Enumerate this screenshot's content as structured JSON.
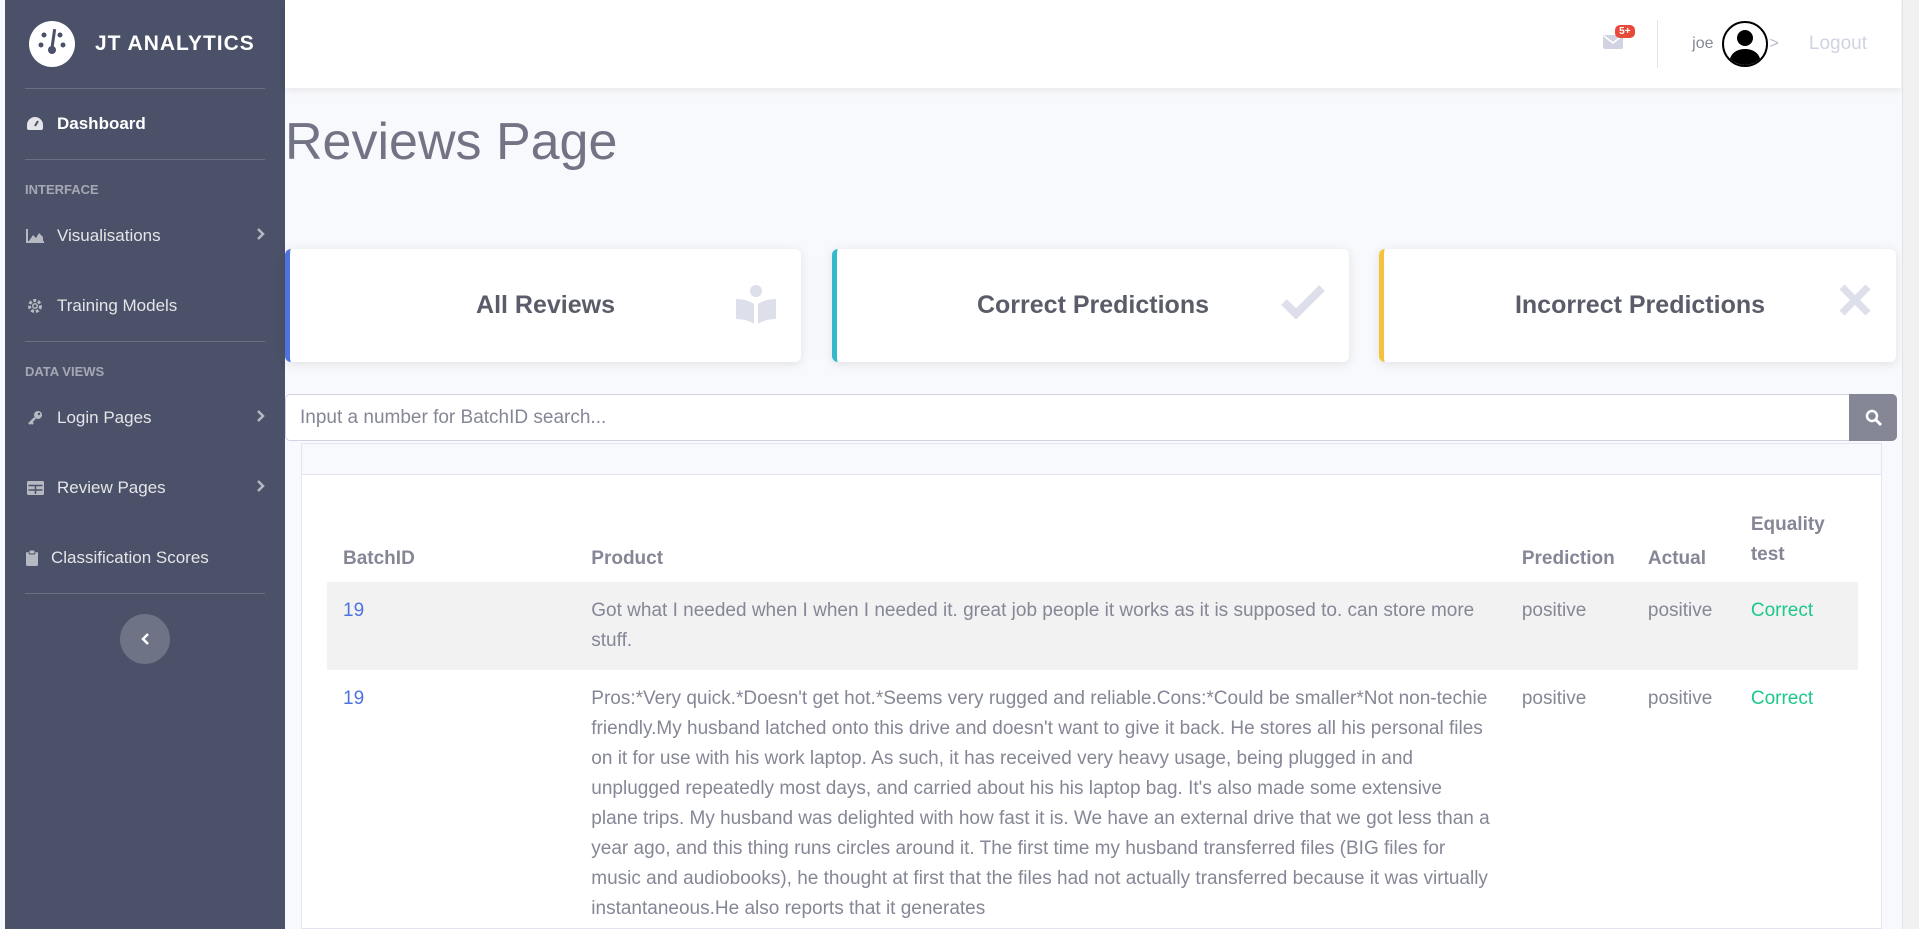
{
  "brand": {
    "name": "JT ANALYTICS",
    "icon": "gauge-icon"
  },
  "sidebar": {
    "dashboard": "Dashboard",
    "section_interface": "INTERFACE",
    "visualisations": "Visualisations",
    "training_models": "Training Models",
    "section_data_views": "DATA VIEWS",
    "login_pages": "Login Pages",
    "review_pages": "Review Pages",
    "classification_scores": "Classification Scores"
  },
  "topbar": {
    "badge": "5+",
    "user": "joe",
    "gt": ">",
    "logout": "Logout"
  },
  "page": {
    "title": "Reviews Page"
  },
  "cards": {
    "all_reviews": "All Reviews",
    "correct": "Correct Predictions",
    "incorrect": "Incorrect Predictions"
  },
  "search": {
    "placeholder": "Input a number for BatchID search..."
  },
  "table": {
    "headers": {
      "batch": "BatchID",
      "product": "Product",
      "prediction": "Prediction",
      "actual": "Actual",
      "equality": "Equality test"
    },
    "rows": [
      {
        "batch": "19",
        "product": "Got what I needed when I when I needed it. great job people it works as it is supposed to. can store more stuff.",
        "prediction": "positive",
        "actual": "positive",
        "equality": "Correct"
      },
      {
        "batch": "19",
        "product": "Pros:*Very quick.*Doesn't get hot.*Seems very rugged and reliable.Cons:*Could be smaller*Not non-techie friendly.My husband latched onto this drive and doesn't want to give it back. He stores all his personal files on it for use with his work laptop. As such, it has received very heavy usage, being plugged in and unplugged repeatedly most days, and carried about his his laptop bag. It's also made some extensive plane trips. My husband was delighted with how fast it is. We have an external drive that we got less than a year ago, and this thing runs circles around it. The first time my husband transferred files (BIG files for music and audiobooks), he thought at first that the files had not actually transferred because it was virtually instantaneous.He also reports that it generates",
        "prediction": "positive",
        "actual": "positive",
        "equality": "Correct"
      }
    ]
  },
  "colors": {
    "sidebar": "#4a5168",
    "primary": "#4e73df",
    "info": "#36b9cc",
    "warning": "#f6c23e",
    "success": "#1cc88a",
    "danger": "#e74a3b"
  }
}
